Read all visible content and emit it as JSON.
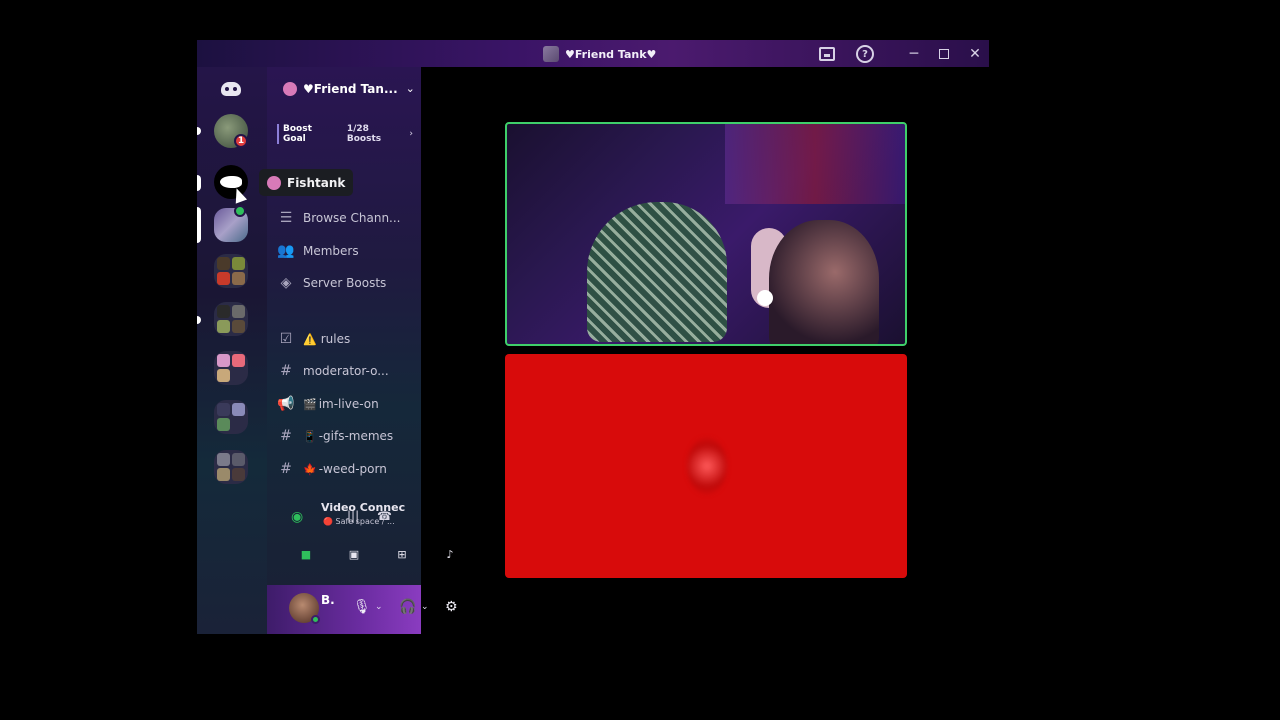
{
  "window": {
    "title": "♥Friend Tank♥",
    "icons": [
      "inbox-icon",
      "help-icon",
      "minimize-icon",
      "maximize-icon",
      "close-icon"
    ],
    "help_glyph": "?"
  },
  "server": {
    "name": "♥Friend Tan...",
    "boost_label": "Boost Goal",
    "boost_count": "1/28 Boosts"
  },
  "server_rail": {
    "notification_badge": "1"
  },
  "tooltip": {
    "label": "Fishtank"
  },
  "channels": [
    {
      "icon": "browse-channels-icon",
      "label": "Browse Chann..."
    },
    {
      "icon": "members-icon",
      "label": "Members"
    },
    {
      "icon": "server-boost-icon",
      "label": "Server Boosts"
    },
    {
      "icon": "rules-icon",
      "emoji": "⚠️",
      "label": "rules"
    },
    {
      "icon": "hashtag-icon",
      "label": "moderator-o..."
    },
    {
      "icon": "announcement-icon",
      "emoji": "🎬",
      "label": "im-live-on"
    },
    {
      "icon": "hashtag-icon",
      "emoji": "📱",
      "label": "-gifs-memes"
    },
    {
      "icon": "hashtag-icon",
      "emoji": "🍁",
      "label": "-weed-porn"
    }
  ],
  "voice": {
    "title": "Video Connec",
    "subtitle": "🔴 Safe space / ..."
  },
  "user": {
    "name": "B."
  },
  "colors": {
    "accent_green": "#3fcf6a",
    "video_red": "#d80b0b",
    "tooltip_bg": "#1b1d22"
  }
}
